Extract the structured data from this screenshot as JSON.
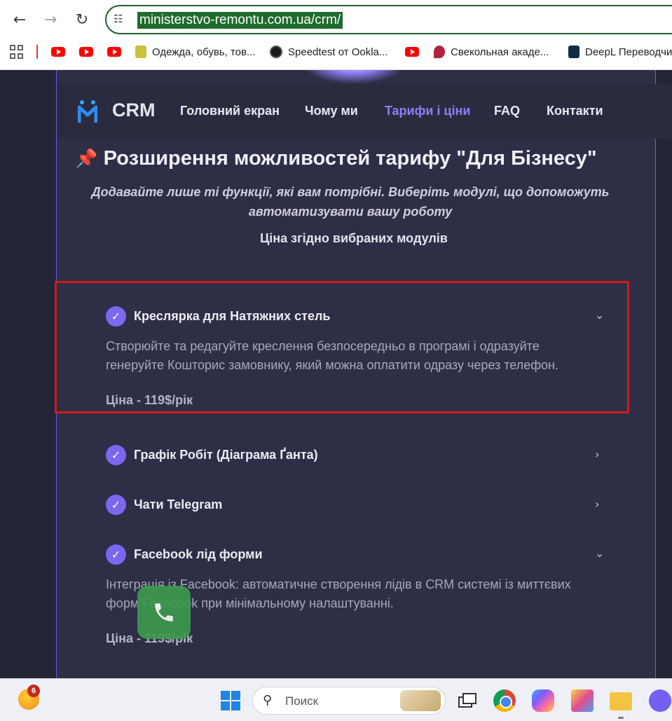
{
  "browser": {
    "url": "ministerstvo-remontu.com.ua/crm/",
    "bookmarks": [
      {
        "label": "",
        "icon": "youtube-icon"
      },
      {
        "label": "",
        "icon": "youtube-icon"
      },
      {
        "label": "",
        "icon": "youtube-icon"
      },
      {
        "label": "Одежда, обувь, тов...",
        "icon": "shop-icon"
      },
      {
        "label": "Speedtest от Ookla...",
        "icon": "speedtest-icon"
      },
      {
        "label": "",
        "icon": "youtube-icon"
      },
      {
        "label": "Свекольная акаде...",
        "icon": "beet-icon"
      },
      {
        "label": "DeepL Переводчи",
        "icon": "deepl-icon"
      }
    ]
  },
  "site": {
    "logo_text": "CRM",
    "nav": [
      {
        "label": "Головний екран",
        "active": false
      },
      {
        "label": "Чому ми",
        "active": false
      },
      {
        "label": "Тарифи і ціни",
        "active": true
      },
      {
        "label": "FAQ",
        "active": false
      },
      {
        "label": "Контакти",
        "active": false
      }
    ],
    "accent_color": "#7b68ee"
  },
  "section": {
    "title": "Розширення можливостей тарифу \"Для Бізнесу\"",
    "subtitle": "Додавайте лише ті функції, які вам потрібні. Виберіть модулі, що допоможуть автоматизувати вашу роботу",
    "price_note": "Ціна згідно вибраних модулів"
  },
  "modules": [
    {
      "title": "Креслярка для Натяжних стель",
      "expanded": true,
      "description": "Створюйте та редагуйте креслення безпосередньо в програмі і одразуйте генеруйте Кошторис замовнику, який можна оплатити одразу через телефон.",
      "price": "Ціна - 119$/рік"
    },
    {
      "title": "Графік Робіт (Діаграма Ґанта)",
      "expanded": false
    },
    {
      "title": "Чати Telegram",
      "expanded": false
    },
    {
      "title": "Facebook лід форми",
      "expanded": true,
      "description": "Інтеграція із Facebook: автоматичне створення лідів в CRM системі із миттєвих форм Facebook при мінімальному налаштуванні.",
      "price": "Ціна - 119$/рік"
    }
  ],
  "taskbar": {
    "search_placeholder": "Поиск",
    "notification_count": "6"
  }
}
